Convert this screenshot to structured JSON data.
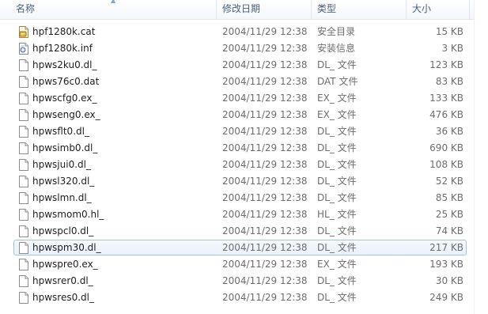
{
  "columns": {
    "name": "名称",
    "modified": "修改日期",
    "type": "类型",
    "size": "大小"
  },
  "files": [
    {
      "name": "hpf1280k.cat",
      "date": "2004/11/29 12:38",
      "type": "安全目录",
      "size": "15 KB",
      "icon": "catalog-icon"
    },
    {
      "name": "hpf1280k.inf",
      "date": "2004/11/29 12:38",
      "type": "安装信息",
      "size": "3 KB",
      "icon": "setup-info-icon"
    },
    {
      "name": "hpws2ku0.dl_",
      "date": "2004/11/29 12:38",
      "type": "DL_ 文件",
      "size": "123 KB",
      "icon": "file-icon"
    },
    {
      "name": "hpws76c0.dat",
      "date": "2004/11/29 12:38",
      "type": "DAT 文件",
      "size": "83 KB",
      "icon": "file-icon"
    },
    {
      "name": "hpwscfg0.ex_",
      "date": "2004/11/29 12:38",
      "type": "EX_ 文件",
      "size": "133 KB",
      "icon": "file-icon"
    },
    {
      "name": "hpwseng0.ex_",
      "date": "2004/11/29 12:38",
      "type": "EX_ 文件",
      "size": "476 KB",
      "icon": "file-icon"
    },
    {
      "name": "hpwsflt0.dl_",
      "date": "2004/11/29 12:38",
      "type": "DL_ 文件",
      "size": "36 KB",
      "icon": "file-icon"
    },
    {
      "name": "hpwsimb0.dl_",
      "date": "2004/11/29 12:38",
      "type": "DL_ 文件",
      "size": "690 KB",
      "icon": "file-icon"
    },
    {
      "name": "hpwsjui0.dl_",
      "date": "2004/11/29 12:38",
      "type": "DL_ 文件",
      "size": "108 KB",
      "icon": "file-icon"
    },
    {
      "name": "hpwsl320.dl_",
      "date": "2004/11/29 12:38",
      "type": "DL_ 文件",
      "size": "52 KB",
      "icon": "file-icon"
    },
    {
      "name": "hpwslmn.dl_",
      "date": "2004/11/29 12:38",
      "type": "DL_ 文件",
      "size": "85 KB",
      "icon": "file-icon"
    },
    {
      "name": "hpwsmom0.hl_",
      "date": "2004/11/29 12:38",
      "type": "HL_ 文件",
      "size": "25 KB",
      "icon": "file-icon"
    },
    {
      "name": "hpwspcl0.dl_",
      "date": "2004/11/29 12:38",
      "type": "DL_ 文件",
      "size": "74 KB",
      "icon": "file-icon"
    },
    {
      "name": "hpwspm30.dl_",
      "date": "2004/11/29 12:38",
      "type": "DL_ 文件",
      "size": "217 KB",
      "icon": "file-icon",
      "selected": true
    },
    {
      "name": "hpwspre0.ex_",
      "date": "2004/11/29 12:38",
      "type": "EX_ 文件",
      "size": "193 KB",
      "icon": "file-icon"
    },
    {
      "name": "hpwsrer0.dl_",
      "date": "2004/11/29 12:38",
      "type": "DL_ 文件",
      "size": "30 KB",
      "icon": "file-icon"
    },
    {
      "name": "hpwsres0.dl_",
      "date": "2004/11/29 12:38",
      "type": "DL_ 文件",
      "size": "249 KB",
      "icon": "file-icon"
    }
  ],
  "colors": {
    "header_text": "#4c607a",
    "selection_border": "#a3c3e6",
    "secondary_text": "#6d6d6d"
  }
}
